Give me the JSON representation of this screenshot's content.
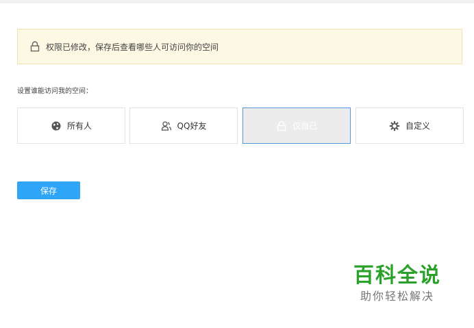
{
  "notice": {
    "icon": "lock-icon",
    "text": "权限已修改，保存后查看哪些人可访问你的空间"
  },
  "access": {
    "label": "设置谁能访问我的空间：",
    "options": [
      {
        "label": "所有人",
        "icon": "globe-icon",
        "selected": false
      },
      {
        "label": "QQ好友",
        "icon": "friends-icon",
        "selected": false
      },
      {
        "label": "仅自己",
        "icon": "lock-icon",
        "selected": true
      },
      {
        "label": "自定义",
        "icon": "gear-icon",
        "selected": false
      }
    ]
  },
  "actions": {
    "save_label": "保存"
  },
  "watermark": {
    "title": "百科全说",
    "subtitle": "助你轻松解决"
  },
  "colors": {
    "notice_bg": "#fdf8e4",
    "accent": "#2ea5f7",
    "selected_border": "#4f97d6",
    "watermark_green": "#2aa22a"
  }
}
